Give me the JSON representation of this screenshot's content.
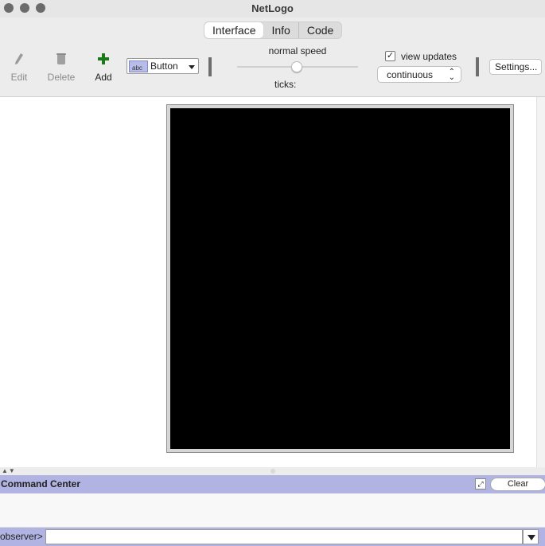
{
  "window": {
    "title": "NetLogo"
  },
  "tabs": [
    {
      "label": "Interface",
      "active": true
    },
    {
      "label": "Info",
      "active": false
    },
    {
      "label": "Code",
      "active": false
    }
  ],
  "toolbar": {
    "edit_label": "Edit",
    "delete_label": "Delete",
    "add_label": "Add",
    "widget_type": "Button",
    "widget_type_icon_text": "abc",
    "speed_label": "normal speed",
    "speed_value": 0.5,
    "ticks_label": "ticks:",
    "view_updates_label": "view updates",
    "view_updates_checked": true,
    "update_mode": "continuous",
    "settings_label": "Settings..."
  },
  "command_center": {
    "title": "Command Center",
    "clear_label": "Clear",
    "prompt": "observer>",
    "input_value": ""
  },
  "colors": {
    "command_center_bar": "#b1b3e2",
    "view_background": "#000000",
    "add_icon": "#1a7a1a"
  }
}
